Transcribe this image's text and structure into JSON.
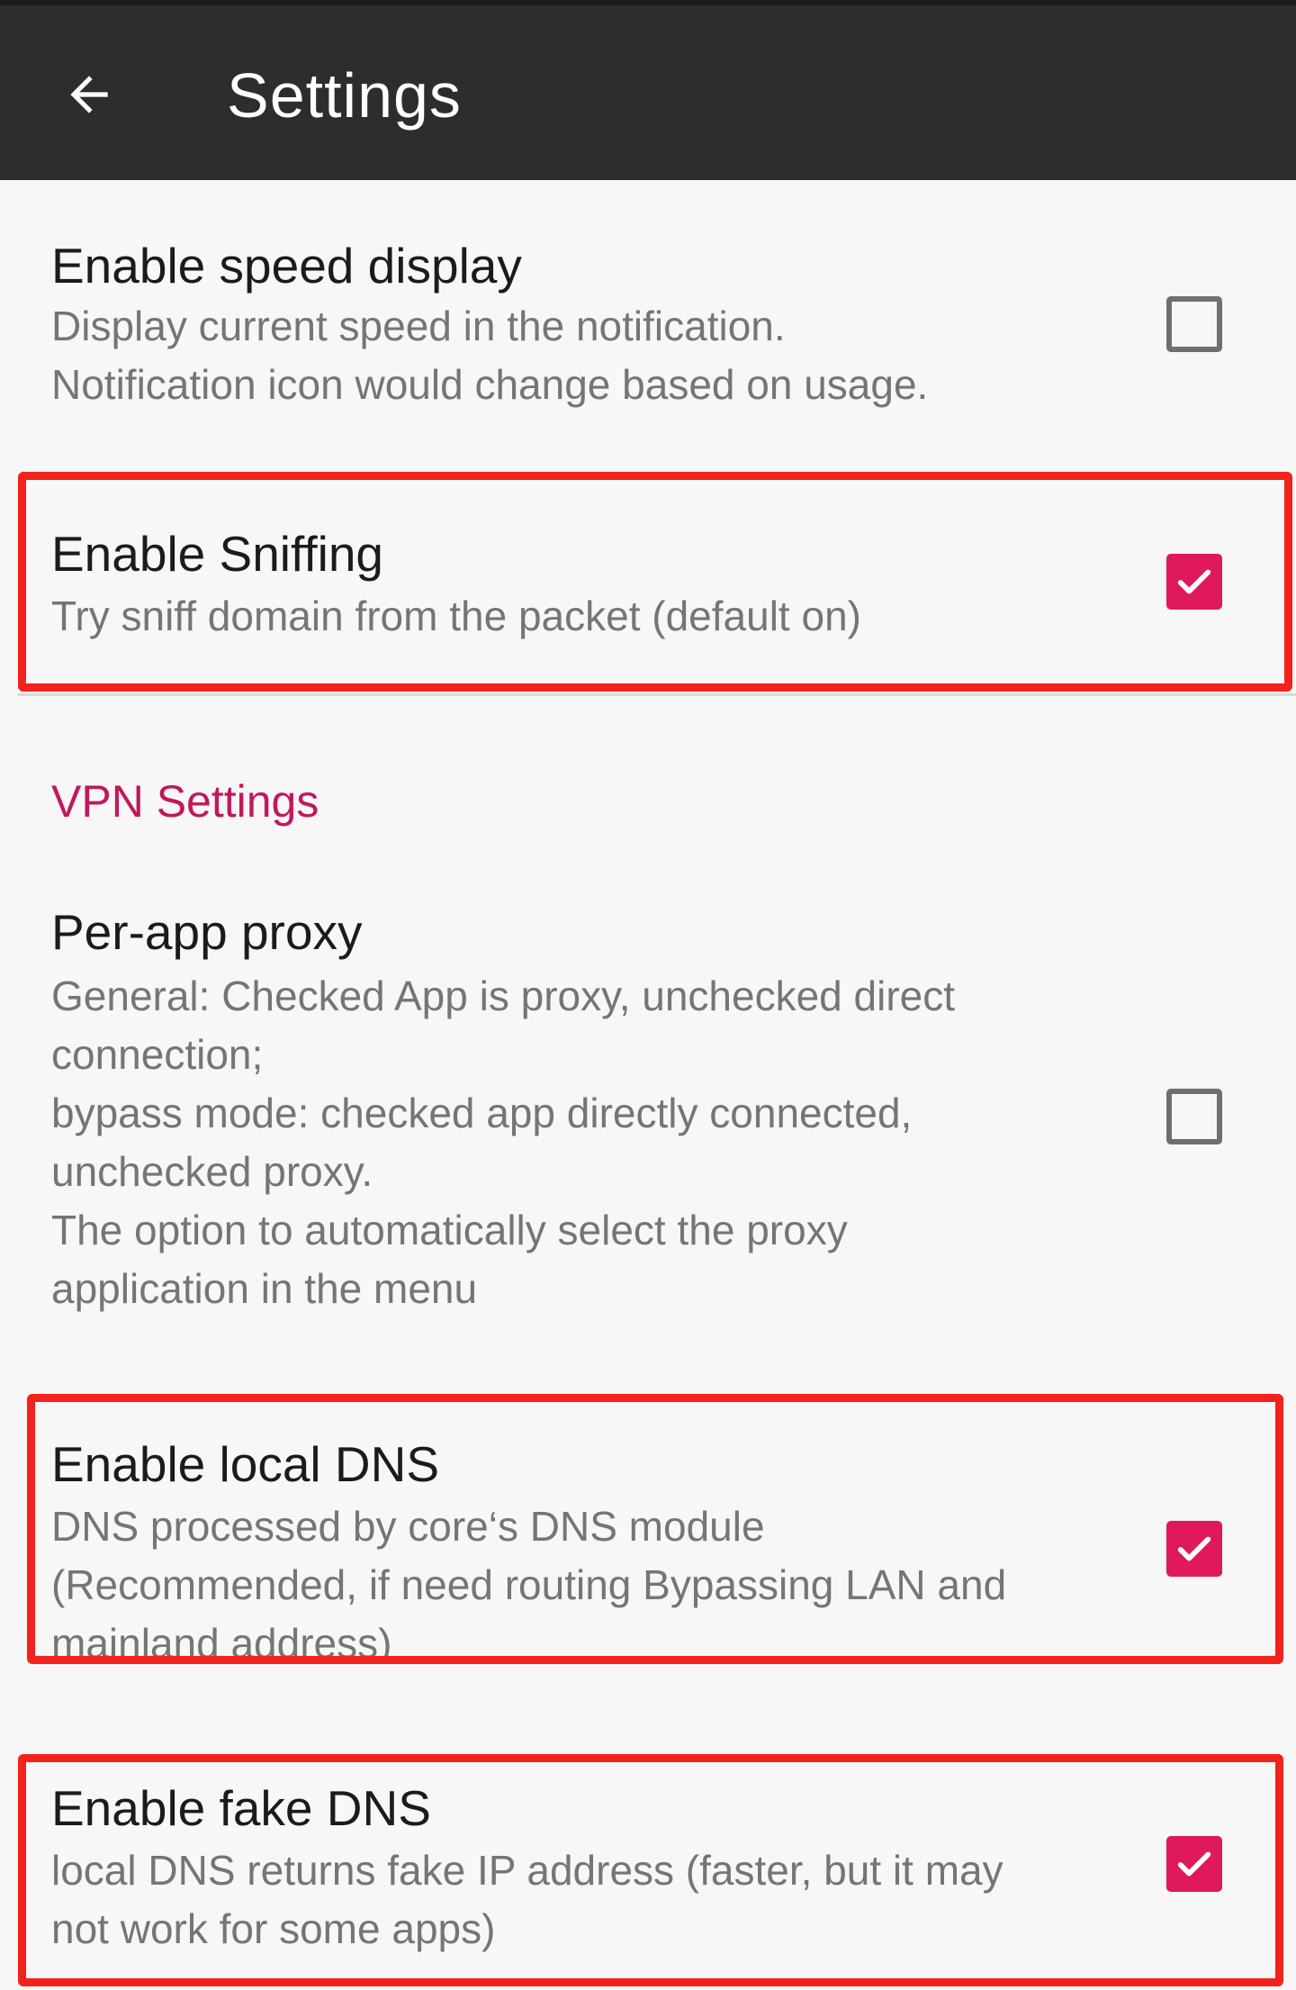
{
  "appbar": {
    "title": "Settings",
    "back_icon": "arrow-back-icon"
  },
  "colors": {
    "appbar_bg": "#2d2d2d",
    "accent": "#e0185c",
    "section_header": "#c2185b",
    "highlight": "#f2231c"
  },
  "prefs": {
    "speed_display": {
      "title": "Enable speed display",
      "summary": "Display current speed in the notification.\nNotification icon would change based on usage.",
      "checked": false
    },
    "sniffing": {
      "title": "Enable Sniffing",
      "summary": "Try sniff domain from the packet (default on)",
      "checked": true
    },
    "vpn_section": {
      "header": "VPN Settings"
    },
    "per_app_proxy": {
      "title": "Per-app proxy",
      "summary": "General: Checked App is proxy, unchecked direct\nconnection;\nbypass mode: checked app directly connected,\nunchecked proxy.\nThe option to automatically select the proxy\napplication in the menu",
      "checked": false
    },
    "local_dns": {
      "title": "Enable local DNS",
      "summary": "DNS processed by core‘s DNS module\n(Recommended, if need routing Bypassing LAN and\nmainland address)",
      "checked": true
    },
    "fake_dns": {
      "title": "Enable fake DNS",
      "summary": "local DNS returns fake IP address (faster, but it may\nnot work for some apps)",
      "checked": true
    }
  }
}
